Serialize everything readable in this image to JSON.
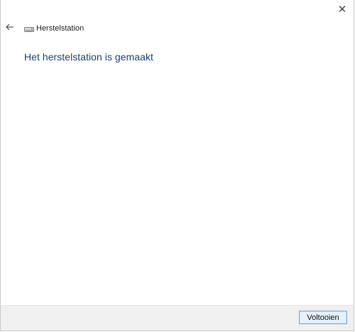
{
  "window": {
    "title": "Herstelstation"
  },
  "main": {
    "heading": "Het herstelstation is gemaakt"
  },
  "footer": {
    "finish_label": "Voltooien"
  },
  "icons": {
    "back": "back-arrow-icon",
    "close": "close-icon",
    "drive": "drive-icon"
  },
  "colors": {
    "heading": "#1b3e78",
    "footer_bg": "#f0f0f0",
    "button_border": "#7aa7d8",
    "button_bg": "#e5f1fb"
  }
}
